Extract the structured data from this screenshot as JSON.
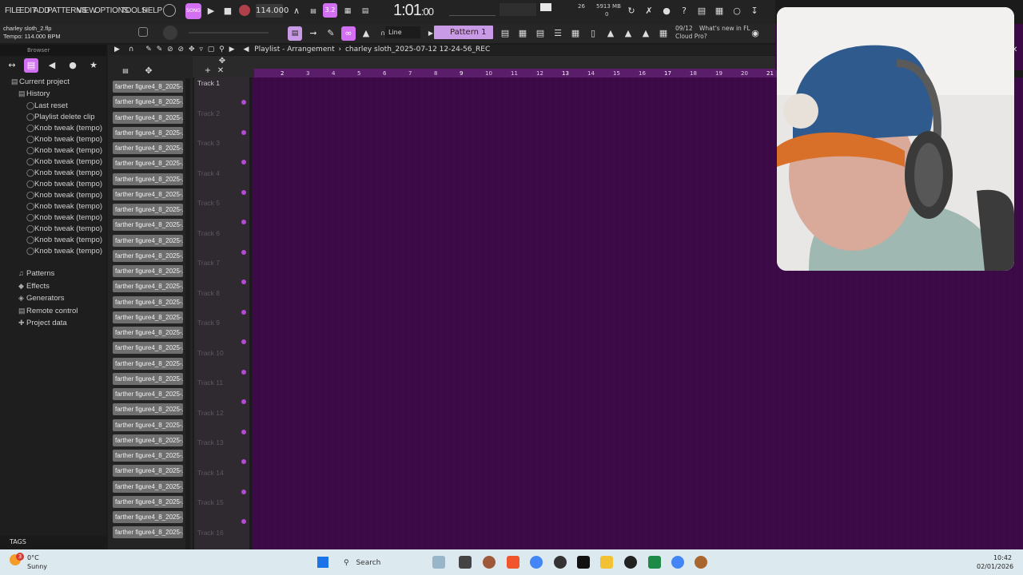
{
  "menu": [
    "FILE",
    "EDIT",
    "ADD",
    "PATTERNS",
    "VIEW",
    "OPTIONS",
    "TOOLS",
    "HELP"
  ],
  "project": {
    "file": "charley sloth_2.flp",
    "tempo_hint": "Tempo: 114.000 BPM"
  },
  "transport": {
    "tempo": "114.000",
    "time_main": "1:01",
    "time_sub": ":00",
    "rec_mode": "3.2",
    "pattern": "Pattern 1",
    "snap": "Line"
  },
  "stats": {
    "cpu": "26",
    "mem": "5913 MB",
    "voices": "0"
  },
  "news": {
    "date": "09/12",
    "text1": "What's new in FL",
    "text2": "Cloud Pro?"
  },
  "browser": {
    "title": "Browser",
    "current_project": "Current project",
    "history": "History",
    "history_items": [
      "Last reset",
      "Playlist delete clip",
      "Knob tweak (tempo)",
      "Knob tweak (tempo)",
      "Knob tweak (tempo)",
      "Knob tweak (tempo)",
      "Knob tweak (tempo)",
      "Knob tweak (tempo)",
      "Knob tweak (tempo)",
      "Knob tweak (tempo)",
      "Knob tweak (tempo)",
      "Knob tweak (tempo)",
      "Knob tweak (tempo)",
      "Knob tweak (tempo)"
    ],
    "folders": [
      "Patterns",
      "Effects",
      "Generators",
      "Remote control",
      "Project data"
    ],
    "tags": "TAGS"
  },
  "playlist": {
    "title": "Playlist - Arrangement",
    "file": "charley sloth_2025-07-12 12-24-56_REC",
    "tracks": [
      "Track 1",
      "Track 2",
      "Track 3",
      "Track 4",
      "Track 5",
      "Track 6",
      "Track 7",
      "Track 8",
      "Track 9",
      "Track 10",
      "Track 11",
      "Track 12",
      "Track 13",
      "Track 14",
      "Track 15",
      "Track 16"
    ],
    "ruler": [
      "2",
      "3",
      "4",
      "5",
      "6",
      "7",
      "8",
      "9",
      "10",
      "11",
      "12",
      "13",
      "14",
      "15",
      "16",
      "17",
      "18",
      "19",
      "20",
      "21"
    ]
  },
  "clip_label": "farther figure4_8_2025-...",
  "taskbar": {
    "weather_temp": "0°C",
    "weather_text": "Sunny",
    "weather_badge": "3",
    "search": "Search",
    "time": "10:42",
    "date": "02/01/2026"
  },
  "colors": {
    "accent": "#c99be6",
    "playlist_bg": "#3b0a47",
    "highlight": "#d36ff2"
  }
}
